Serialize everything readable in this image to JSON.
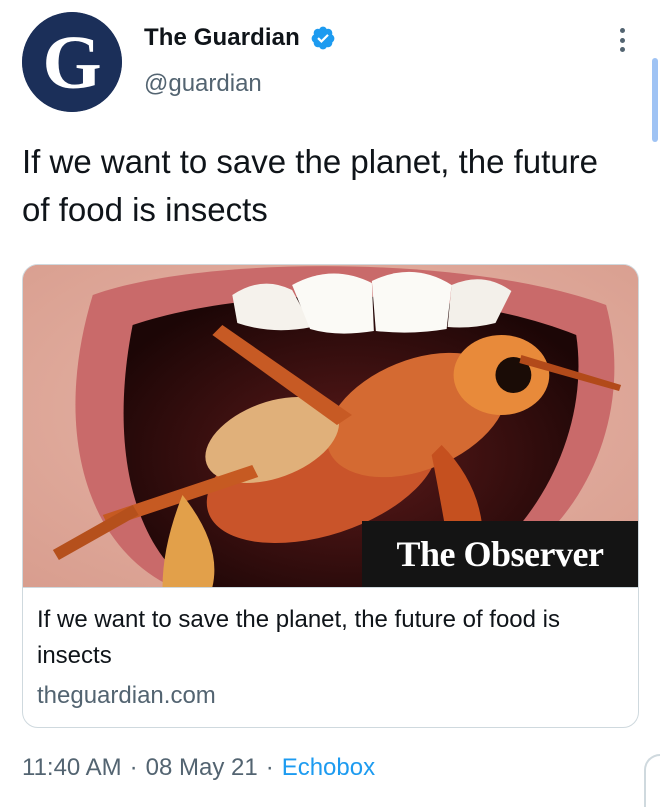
{
  "tweet": {
    "author": {
      "display_name": "The Guardian",
      "handle": "@guardian",
      "verified": true,
      "avatar_icon": "guardian-g-logo",
      "avatar_letter": "G"
    },
    "text": "If we want to save the planet, the future of food is insects",
    "card": {
      "image_icon": "grasshopper-in-mouth-photo",
      "image_overlay_label": "The Observer",
      "title": "If we want to save the planet, the future of food is insects",
      "domain": "theguardian.com"
    },
    "timestamp": {
      "time": "11:40 AM",
      "separator": "·",
      "date": "08 May 21",
      "source": "Echobox"
    }
  },
  "colors": {
    "text_primary": "#0f1419",
    "text_secondary": "#536471",
    "accent": "#1d9bf0",
    "avatar_bg": "#1b2f59",
    "border": "#cfd9de"
  }
}
